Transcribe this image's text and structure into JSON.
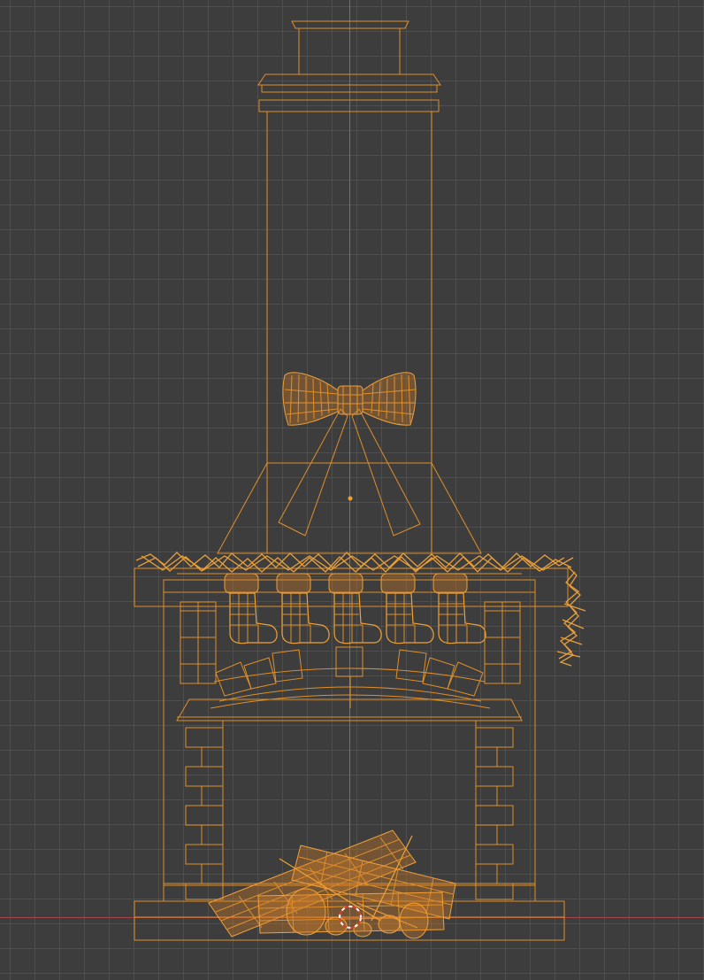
{
  "viewport": {
    "background": "#3d3d3d",
    "grid_color": "#5a5a5a",
    "axis_z_color": "#4a78c8",
    "axis_x_color": "#a8454b",
    "selection_color": "#e08f2a"
  },
  "scene": {
    "object": "fireplace-wireframe",
    "stocking_count": 5
  }
}
